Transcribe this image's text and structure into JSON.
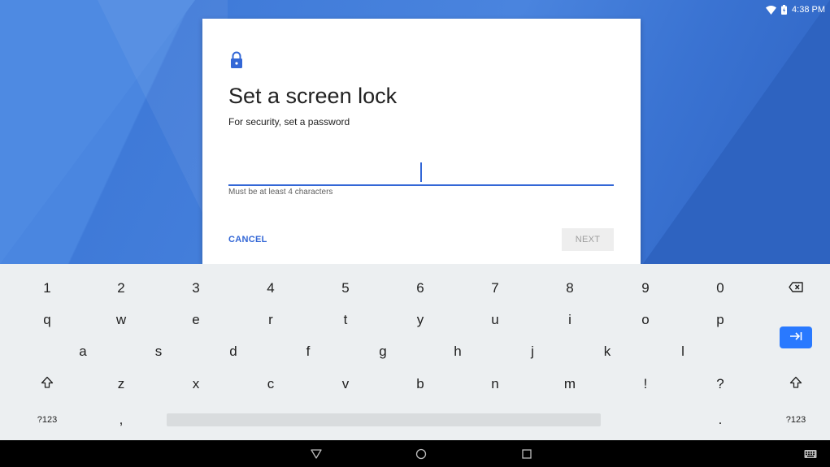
{
  "status_bar": {
    "time": "4:38 PM",
    "icons": [
      "wifi-icon",
      "battery-icon"
    ]
  },
  "dialog": {
    "icon": "lock-icon",
    "title": "Set a screen lock",
    "subtitle": "For security, set a password",
    "password_value": "",
    "helper_text": "Must be at least 4 characters",
    "cancel_label": "CANCEL",
    "next_label": "NEXT",
    "accent_color": "#3367d6"
  },
  "keyboard": {
    "rows": [
      [
        "1",
        "2",
        "3",
        "4",
        "5",
        "6",
        "7",
        "8",
        "9",
        "0"
      ],
      [
        "q",
        "w",
        "e",
        "r",
        "t",
        "y",
        "u",
        "i",
        "o",
        "p"
      ],
      [
        "a",
        "s",
        "d",
        "f",
        "g",
        "h",
        "j",
        "k",
        "l"
      ],
      [
        "z",
        "x",
        "c",
        "v",
        "b",
        "n",
        "m",
        "!",
        "?"
      ]
    ],
    "symbols_label": "?123",
    "comma": ",",
    "period": ".",
    "backspace_icon": "backspace-icon",
    "enter_icon": "tab-arrow-icon",
    "shift_icon": "shift-icon",
    "enter_color": "#2979ff"
  },
  "nav_bar": {
    "items": [
      "back-icon",
      "home-icon",
      "recents-icon",
      "keyboard-icon"
    ]
  }
}
